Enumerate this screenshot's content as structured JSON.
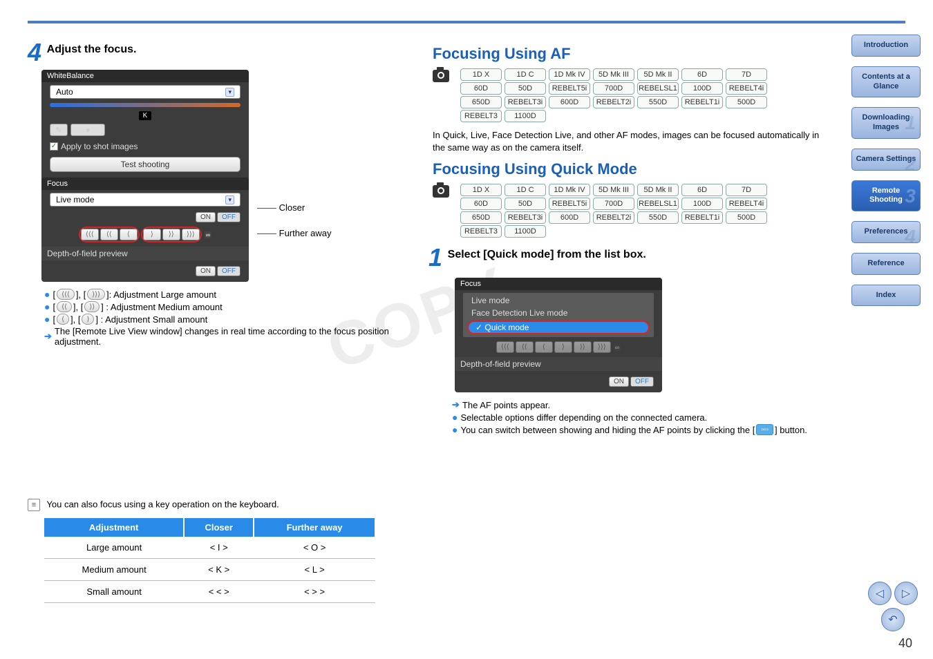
{
  "pageNumber": "40",
  "watermark": "COPY",
  "left": {
    "stepNum": "4",
    "stepTitle": "Adjust the focus.",
    "panel": {
      "wb_header": "WhiteBalance",
      "wb_value": "Auto",
      "k_label": "K",
      "apply_shot": "Apply to shot images",
      "test_shoot": "Test shooting",
      "focus_header": "Focus",
      "focus_mode": "Live mode",
      "on": "ON",
      "off": "OFF",
      "dof": "Depth-of-field preview"
    },
    "anno_closer": "Closer",
    "anno_further": "Further away",
    "bullets": {
      "b1a": "[ ",
      "b1_icon1": "⟨⟨⟨",
      "b1b": " ], [ ",
      "b1_icon2": "⟩⟩⟩",
      "b1c": " ]: Adjustment  Large amount",
      "b2a": "[ ",
      "b2_icon1": "⟨⟨",
      "b2b": " ], [ ",
      "b2_icon2": "⟩⟩",
      "b2c": " ] : Adjustment  Medium amount",
      "b3a": "[ ",
      "b3_icon1": "⟨",
      "b3b": " ], [ ",
      "b3_icon2": "⟩",
      "b3c": " ] : Adjustment  Small amount",
      "b4": "The [Remote Live View window] changes in real time according to the focus position adjustment."
    },
    "note_text": "You can also focus using a key operation on the keyboard.",
    "table": {
      "h1": "Adjustment",
      "h2": "Closer",
      "h3": "Further away",
      "r1c1": "Large amount",
      "r1c2": "< I >",
      "r1c3": "< O >",
      "r2c1": "Medium amount",
      "r2c2": "< K >",
      "r2c3": "< L >",
      "r3c1": "Small amount",
      "r3c2": "< < >",
      "r3c3": "< > >"
    }
  },
  "right": {
    "hdr1": "Focusing Using AF",
    "models_row1": [
      "1D X",
      "1D C",
      "1D Mk IV",
      "5D Mk III",
      "5D Mk II",
      "6D",
      "7D"
    ],
    "models_row2": [
      "60D",
      "50D",
      "REBELT5i",
      "700D",
      "REBELSL1",
      "100D",
      "REBELT4i"
    ],
    "models_row3": [
      "650D",
      "REBELT3i",
      "600D",
      "REBELT2i",
      "550D",
      "REBELT1i",
      "500D"
    ],
    "models_row4": [
      "REBELT3",
      "1100D"
    ],
    "af_desc": "In Quick, Live, Face Detection Live, and other AF modes, images can be focused automatically in the same way as on the camera itself.",
    "hdr2": "Focusing Using Quick Mode",
    "step1_num": "1",
    "step1_title": "Select [Quick mode] from the list box.",
    "quick_panel": {
      "focus": "Focus",
      "live": "Live mode",
      "face": "Face Detection Live mode",
      "quick": "Quick mode",
      "dof": "Depth-of-field preview",
      "on": "ON",
      "off": "OFF"
    },
    "post_bullets": {
      "p1": "The AF points appear.",
      "p2": "Selectable options differ depending on the connected camera.",
      "p3a": "You can switch between showing and hiding the AF points by clicking the [ ",
      "p3b": " ] button."
    }
  },
  "sidebar": {
    "intro": "Introduction",
    "contents": "Contents at a Glance",
    "down": "Downloading Images",
    "cam": "Camera Settings",
    "remote": "Remote Shooting",
    "pref": "Preferences",
    "ref": "Reference",
    "index": "Index"
  }
}
